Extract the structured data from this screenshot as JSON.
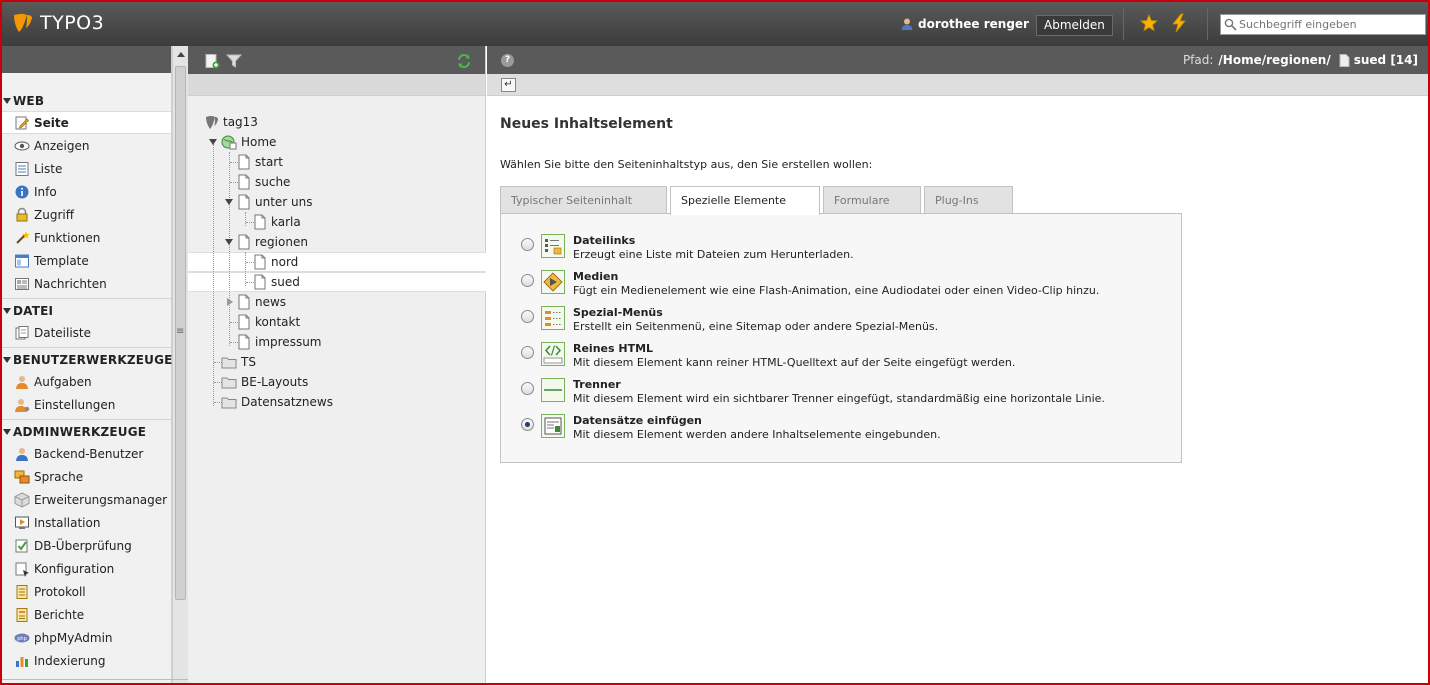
{
  "topbar": {
    "logo_text": "TYPO3",
    "user_name": "dorothee renger",
    "logout_label": "Abmelden",
    "search_placeholder": "Suchbegriff eingeben"
  },
  "module_menu": {
    "groups": [
      {
        "label": "WEB",
        "items": [
          {
            "label": "Seite",
            "icon": "page-edit-icon"
          },
          {
            "label": "Anzeigen",
            "icon": "eye-icon"
          },
          {
            "label": "Liste",
            "icon": "list-icon"
          },
          {
            "label": "Info",
            "icon": "info-icon"
          },
          {
            "label": "Zugriff",
            "icon": "lock-icon"
          },
          {
            "label": "Funktionen",
            "icon": "wand-icon"
          },
          {
            "label": "Template",
            "icon": "template-icon"
          },
          {
            "label": "Nachrichten",
            "icon": "news-icon"
          }
        ]
      },
      {
        "label": "DATEI",
        "items": [
          {
            "label": "Dateiliste",
            "icon": "filelist-icon"
          }
        ]
      },
      {
        "label": "BENUTZERWERKZEUGE",
        "items": [
          {
            "label": "Aufgaben",
            "icon": "tasks-icon"
          },
          {
            "label": "Einstellungen",
            "icon": "user-settings-icon"
          }
        ]
      },
      {
        "label": "ADMINWERKZEUGE",
        "items": [
          {
            "label": "Backend-Benutzer",
            "icon": "backend-user-icon"
          },
          {
            "label": "Sprache",
            "icon": "language-icon"
          },
          {
            "label": "Erweiterungsmanager",
            "icon": "extension-icon"
          },
          {
            "label": "Installation",
            "icon": "install-icon"
          },
          {
            "label": "DB-Überprüfung",
            "icon": "db-check-icon"
          },
          {
            "label": "Konfiguration",
            "icon": "config-icon"
          },
          {
            "label": "Protokoll",
            "icon": "log-icon"
          },
          {
            "label": "Berichte",
            "icon": "reports-icon"
          },
          {
            "label": "phpMyAdmin",
            "icon": "phpmyadmin-icon"
          },
          {
            "label": "Indexierung",
            "icon": "index-icon"
          }
        ]
      }
    ]
  },
  "page_tree": {
    "root": "tag13",
    "nodes": [
      "Home",
      "start",
      "suche",
      "unter uns",
      "karla",
      "regionen",
      "nord",
      "sued",
      "news",
      "kontakt",
      "impressum",
      "TS",
      "BE-Layouts",
      "Datensatznews"
    ]
  },
  "content": {
    "path_label": "Pfad:",
    "path_value": "/Home/regionen/",
    "page_ref": "sued [14]",
    "title": "Neues Inhaltselement",
    "intro": "Wählen Sie bitte den Seiteninhaltstyp aus, den Sie erstellen wollen:",
    "tabs": [
      "Typischer Seiteninhalt",
      "Spezielle Elemente",
      "Formulare",
      "Plug-Ins"
    ],
    "active_tab": "Spezielle Elemente",
    "elements": [
      {
        "title": "Dateilinks",
        "desc": "Erzeugt eine Liste mit Dateien zum Herunterladen.",
        "selected": false
      },
      {
        "title": "Medien",
        "desc": "Fügt ein Medienelement wie eine Flash-Animation, eine Audiodatei oder einen Video-Clip hinzu.",
        "selected": false
      },
      {
        "title": "Spezial-Menüs",
        "desc": "Erstellt ein Seitenmenü, eine Sitemap oder andere Spezial-Menüs.",
        "selected": false
      },
      {
        "title": "Reines HTML",
        "desc": "Mit diesem Element kann reiner HTML-Quelltext auf der Seite eingefügt werden.",
        "selected": false
      },
      {
        "title": "Trenner",
        "desc": "Mit diesem Element wird ein sichtbarer Trenner eingefügt, standardmäßig eine horizontale Linie.",
        "selected": false
      },
      {
        "title": "Datensätze einfügen",
        "desc": "Mit diesem Element werden andere Inhaltselemente eingebunden.",
        "selected": true
      }
    ]
  },
  "colors": {
    "brand": "#f49700",
    "header_bg": "#4a4a4a",
    "frame_border": "#c8000a"
  }
}
